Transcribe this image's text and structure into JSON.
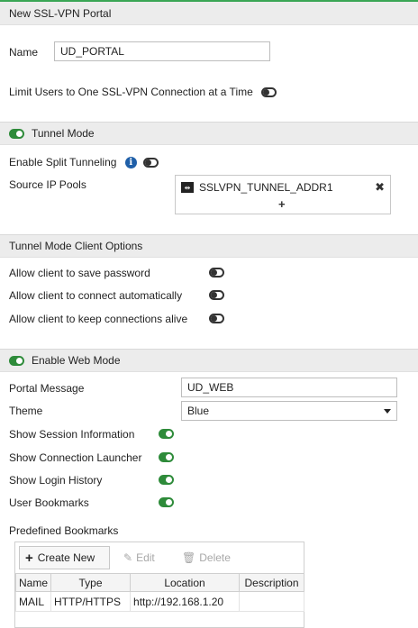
{
  "window": {
    "title": "New SSL-VPN Portal"
  },
  "general": {
    "name_label": "Name",
    "name_value": "UD_PORTAL",
    "limit_users_label": "Limit Users to One SSL-VPN Connection at a Time",
    "limit_users_enabled": false
  },
  "tunnel_mode": {
    "header": "Tunnel Mode",
    "enabled": true,
    "split_tunneling_label": "Enable Split Tunneling",
    "split_tunneling_enabled": false,
    "source_ip_pools_label": "Source IP Pools",
    "pools": [
      "SSLVPN_TUNNEL_ADDR1"
    ],
    "add_symbol": "+",
    "remove_symbol": "✖"
  },
  "client_options": {
    "header": "Tunnel Mode Client Options",
    "items": [
      {
        "label": "Allow client to save password",
        "enabled": false
      },
      {
        "label": "Allow client to connect automatically",
        "enabled": false
      },
      {
        "label": "Allow client to keep connections alive",
        "enabled": false
      }
    ]
  },
  "web_mode": {
    "header": "Enable Web Mode",
    "enabled": true,
    "portal_message_label": "Portal Message",
    "portal_message_value": "UD_WEB",
    "theme_label": "Theme",
    "theme_value": "Blue",
    "options": [
      {
        "label": "Show Session Information",
        "enabled": true
      },
      {
        "label": "Show Connection Launcher",
        "enabled": true
      },
      {
        "label": "Show Login History",
        "enabled": true
      },
      {
        "label": "User Bookmarks",
        "enabled": true
      }
    ],
    "predefined_bookmarks_label": "Predefined Bookmarks"
  },
  "bookmarks": {
    "toolbar": {
      "create": "Create New",
      "edit": "Edit",
      "delete": "Delete"
    },
    "columns": [
      "Name",
      "Type",
      "Location",
      "Description"
    ],
    "rows": [
      [
        "MAIL",
        "HTTP/HTTPS",
        "http://192.168.1.20",
        ""
      ]
    ]
  },
  "colors": {
    "toggle_on": "#2e8b3a",
    "info_icon": "#1f5fa8",
    "header_bg": "#ececec"
  }
}
